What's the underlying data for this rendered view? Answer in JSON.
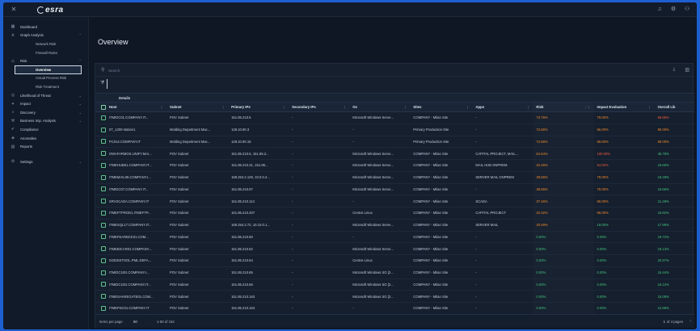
{
  "app": {
    "name": "esra"
  },
  "topbar": {
    "icons": [
      "bell-icon",
      "gear-icon",
      "user-icon"
    ]
  },
  "sidebar": {
    "items": [
      {
        "label": "Dashboard",
        "icon": "grid-icon",
        "level": 0
      },
      {
        "label": "Graph Analysis",
        "icon": "graph-icon",
        "level": 0,
        "chevron": "up"
      },
      {
        "label": "Network Risk",
        "level": 1
      },
      {
        "label": "Firewall Rules",
        "level": 1
      },
      {
        "label": "Risk",
        "icon": "warning-icon",
        "level": 0,
        "chevron": "up"
      },
      {
        "label": "Overview",
        "level": 1,
        "active": true
      },
      {
        "label": "Actual Process Risk",
        "level": 1
      },
      {
        "label": "Risk Treatment",
        "level": 1
      },
      {
        "label": "Likelihood of Threat",
        "icon": "threat-icon",
        "level": 0,
        "chevron": "down"
      },
      {
        "label": "Impact",
        "icon": "impact-icon",
        "level": 0,
        "chevron": "down"
      },
      {
        "label": "Discovery",
        "icon": "discovery-icon",
        "level": 0,
        "chevron": "down"
      },
      {
        "label": "Business Imp. Analysis",
        "icon": "business-icon",
        "level": 0,
        "chevron": "down"
      },
      {
        "label": "Compliance",
        "icon": "compliance-icon",
        "level": 0
      },
      {
        "label": "Anomalies",
        "icon": "anomalies-icon",
        "level": 0
      },
      {
        "label": "Reports",
        "icon": "reports-icon",
        "level": 0
      },
      {
        "label": "Settings",
        "icon": "gear-icon",
        "level": 0,
        "chevron": "down",
        "gap": true
      }
    ]
  },
  "page": {
    "title": "Overview"
  },
  "search": {
    "placeholder": "Search"
  },
  "table": {
    "group_label": "Details",
    "columns": [
      "Host",
      "Subnet",
      "Primary IPs",
      "Secondary IPs",
      "Os",
      "Sites",
      "Apps",
      "Risk",
      "Impact Evaluation",
      "Overall Lik"
    ],
    "rows": [
      [
        "ITMIDC01.COMPANY.IT...",
        "POV Subnet",
        "151.85.210.5",
        "-",
        "Microsoft Windows Serve...",
        "COMPANY - Milan Site",
        "-",
        "73.76%",
        "79.00%",
        "68.86%"
      ],
      [
        "IIT_1200-station1",
        "Molding Department Mac...",
        "128.10.90.3",
        "-",
        "-",
        "Primary Production Site",
        "-",
        "72.66%",
        "66.00%",
        "80.00%"
      ],
      [
        "PC014.COMPANY.IT",
        "Molding Department Mac...",
        "128.10.90.15",
        "-",
        "-",
        "Primary Production Site",
        "-",
        "72.66%",
        "66.00%",
        "80.00%"
      ],
      [
        "OWAFARMOS.UNIFY.MAI...",
        "POV Subnet",
        "151.85.210.5, 151.85.2...",
        "-",
        "Microsoft Windows Serve...",
        "COMPANY - Milan Site",
        "CAPITAL PROJECT, MAIL...",
        "64.64%",
        "100.00%",
        "45.78%"
      ],
      [
        "ITMEHUB01.COMPANY.IT...",
        "POV Subnet",
        "151.85.210.31, 151.85...",
        "-",
        "Microsoft Windows Serve...",
        "COMPANY - Milan Site",
        "MAIL HUB ONPREM",
        "42.46%",
        "94.00%",
        "19.66%"
      ],
      [
        "ITMEMAIL06.COMPANY.I...",
        "POV Subnet",
        "169.254.2.129, 10.0.0.2...",
        "-",
        "Microsoft Windows Serve...",
        "COMPANY - Milan Site",
        "SERVER MAIL ONPREM",
        "39.56%",
        "79.00%",
        "19.29%"
      ],
      [
        "ITMIDC07.COMPANY.IT...",
        "POV Subnet",
        "151.85.210.97",
        "-",
        "Microsoft Windows Serve...",
        "COMPANY - Milan Site",
        "-",
        "38.86%",
        "79.00%",
        "19.66%"
      ],
      [
        "SRVSCADA.COMPANY.IT",
        "POV Subnet",
        "151.85.210.114",
        "-",
        "-",
        "COMPANY - Milan Site",
        "SCADA",
        "37.46%",
        "66.00%",
        "21.49%"
      ],
      [
        "ITMEFTPROD1.ITMEFTP...",
        "POV Subnet",
        "151.85.210.207",
        "-",
        "Centos Linux",
        "COMPANY - Milan Site",
        "CAPITAL PROJECT",
        "32.32%",
        "66.00%",
        "16.82%"
      ],
      [
        "ITMESQL17.COMPANY.IT...",
        "POV Subnet",
        "169.254.2.72, 10.10.0.1...",
        "-",
        "Microsoft Windows Serve...",
        "COMPANY - Milan Site",
        "SERVER MAIL",
        "20.49%",
        "19.00%",
        "17.99%"
      ],
      [
        "ITMEFEARBCK01.COM...",
        "POV Subnet",
        "151.85.210.60",
        "-",
        "-",
        "COMPANY - Milan Site",
        "-",
        "0.00%",
        "0.00%",
        "19.72%"
      ],
      [
        "ITMEBICAR01.COMPANY....",
        "POV Subnet",
        "151.85.210.62",
        "-",
        "Microsoft Windows Serve...",
        "COMPANY - Milan Site",
        "-",
        "0.00%",
        "0.00%",
        "19.13%"
      ],
      [
        "SOD3ISTOOL.PML.DEFA...",
        "POV Subnet",
        "151.85.210.64",
        "-",
        "Centos Linux",
        "COMPANY - Milan Site",
        "-",
        "0.00%",
        "0.00%",
        "20.97%"
      ],
      [
        "ITMIDC10G.COMPANY.I...",
        "POV Subnet",
        "151.85.210.65",
        "-",
        "Microsoft Windows SO [2...",
        "COMPANY - Milan Site",
        "-",
        "0.00%",
        "0.00%",
        "15.44%"
      ],
      [
        "ITMIDC10G.COMPANY.IT...",
        "POV Subnet",
        "151.85.210.66",
        "-",
        "Microsoft Windows SO [2...",
        "COMPANY - Milan Site",
        "-",
        "0.00%",
        "0.00%",
        "16.12%"
      ],
      [
        "ITMESHAREGATE01.COM...",
        "POV Subnet",
        "151.85.210.163",
        "-",
        "Microsoft Windows SO [2...",
        "COMPANY - Milan Site",
        "-",
        "0.00%",
        "0.00%",
        "15.09%"
      ],
      [
        "ITMEPSC01.COMPANY.IT",
        "POV Subnet",
        "151.85.210.164",
        "-",
        "-",
        "COMPANY - Milan Site",
        "-",
        "0.00%",
        "0.00%",
        "12.99%"
      ]
    ],
    "risk_colors": [
      "orange",
      "orange",
      "orange",
      "orange",
      "orange",
      "orange",
      "orange",
      "orange",
      "orange",
      "orange",
      "green",
      "green",
      "green",
      "green",
      "green",
      "green",
      "green"
    ],
    "impact_colors": [
      "orange",
      "orange",
      "orange",
      "red",
      "red",
      "orange",
      "orange",
      "orange",
      "orange",
      "green",
      "green",
      "green",
      "green",
      "green",
      "green",
      "green",
      "green"
    ],
    "overall_colors": [
      "red",
      "orange",
      "orange",
      "green",
      "green",
      "green",
      "green",
      "green",
      "green",
      "green",
      "green",
      "green",
      "green",
      "green",
      "green",
      "green",
      "green"
    ]
  },
  "pagination": {
    "items_per_page_label": "Items per page",
    "items_per_page": "50",
    "range": "1-50 of 152",
    "page": "1",
    "of_pages": "of 4 pages"
  },
  "colors": {
    "orange": "#f08a2a",
    "red": "#ef5b3a",
    "green": "#45c47a",
    "accent": "#1d5fd0"
  }
}
